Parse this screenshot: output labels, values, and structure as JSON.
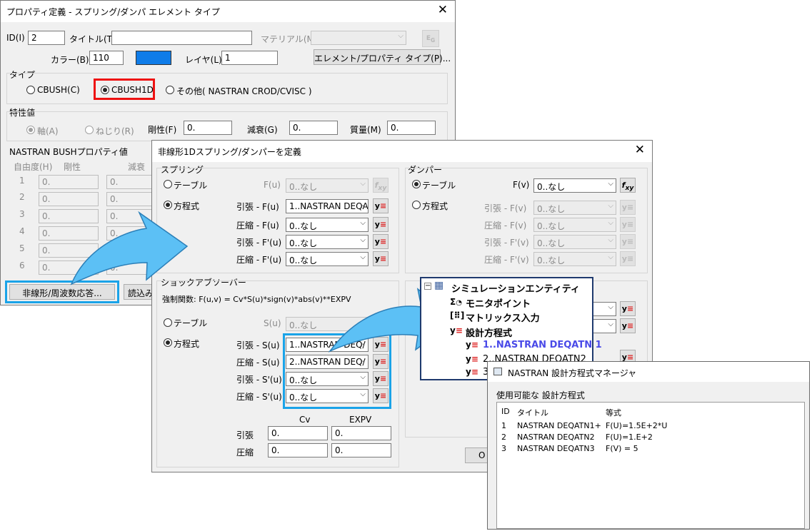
{
  "prop_dialog": {
    "title": "プロパティ定義 - スプリング/ダンパ エレメント タイプ",
    "id_label": "ID(I)",
    "id_value": "2",
    "title_label": "タイトル(T)",
    "title_value": "",
    "material_label": "マテリアル(M)",
    "color_label": "カラー(B)",
    "color_value": "110",
    "color_swatch": "#0f7ce8",
    "layer_label": "レイヤ(L)",
    "layer_value": "1",
    "element_type_button": "エレメント/プロパティ タイプ(P)...",
    "type_group": "タイプ",
    "type_options": [
      "CBUSH(C)",
      "CBUSH1D",
      "その他( NASTRAN CROD/CVISC )"
    ],
    "type_selected": "CBUSH1D",
    "props_group": "特性値",
    "axis_label": "軸(A)",
    "torsion_label": "ねじり(R)",
    "stiffness_label": "剛性(F)",
    "stiffness_value": "0.",
    "damping_label": "減衰(G)",
    "damping_value": "0.",
    "mass_label": "質量(M)",
    "mass_value": "0.",
    "bush_group": "NASTRAN BUSHプロパティ値",
    "dof_label": "自由度(H)",
    "stiff_col": "剛性",
    "damp_col": "減衰",
    "dof_rows": [
      "1",
      "2",
      "3",
      "4",
      "5",
      "6"
    ],
    "dof_value": "0.",
    "nonlinear_button": "非線形/周波数応答...",
    "load_button": "読込み"
  },
  "nl_dialog": {
    "title": "非線形1Dスプリング/ダンパーを定義",
    "spring_group": "スプリング",
    "damper_group": "ダンパー",
    "shock_group": "ショックアブソーバー",
    "table_label": "テーブル",
    "equation_label": "方程式",
    "f_u_label": "F(u)",
    "f_v_label": "F(v)",
    "none_value": "0..なし",
    "tension_f_u": "引張 - F(u)",
    "comp_f_u": "圧縮 - F(u)",
    "tension_fp_u": "引張 - F'(u)",
    "comp_fp_u": "圧縮 - F'(u)",
    "tension_f_v": "引張 - F(v)",
    "comp_f_v": "圧縮 - F(v)",
    "tension_fp_v": "引張 - F'(v)",
    "comp_fp_v": "圧縮 - F'(v)",
    "spring_tension_value": "1..NASTRAN DEQA",
    "shock_formula": "強制関数: F(u,v) = Cv*S(u)*sign(v)*abs(v)**EXPV",
    "s_u_label": "S(u)",
    "tension_s_u": "引張 - S(u)",
    "comp_s_u": "圧縮 - S(u)",
    "tension_sp_u": "引張 - S'(u)",
    "comp_sp_u": "圧縮 - S'(u)",
    "shock_tension_value": "1..NASTRAN DEQ/",
    "shock_comp_value": "2..NASTRAN DEQ/",
    "cv_label": "Cv",
    "expv_label": "EXPV",
    "tension_label": "引張",
    "comp_label": "圧縮",
    "zero": "0.",
    "ok_partial": "O"
  },
  "tree_popup": {
    "root": "シミュレーションエンティティ",
    "items": [
      "モニタポイント",
      "マトリックス入力",
      "設計方程式"
    ],
    "children": [
      "1..NASTRAN DEQATN 1",
      "2..NASTRAN DEQATN2",
      "3"
    ],
    "child_highlight": "#4a4ae8"
  },
  "deq_manager": {
    "title": "NASTRAN 設計方程式マネージャ",
    "available_label": "使用可能な 設計方程式",
    "columns": [
      "ID",
      "タイトル",
      "等式"
    ],
    "rows": [
      {
        "id": "1",
        "title": "NASTRAN DEQATN1+",
        "eq": "F(U)=1.5E+2*U"
      },
      {
        "id": "2",
        "title": "NASTRAN DEQATN2",
        "eq": "F(U)=1.E+2"
      },
      {
        "id": "3",
        "title": "NASTRAN DEQATN3",
        "eq": "F(V) = 5"
      }
    ]
  },
  "colors": {
    "red_highlight": "#e11111",
    "blue_highlight": "#1aa3e8",
    "arrow_fill": "#5cc0f5"
  }
}
